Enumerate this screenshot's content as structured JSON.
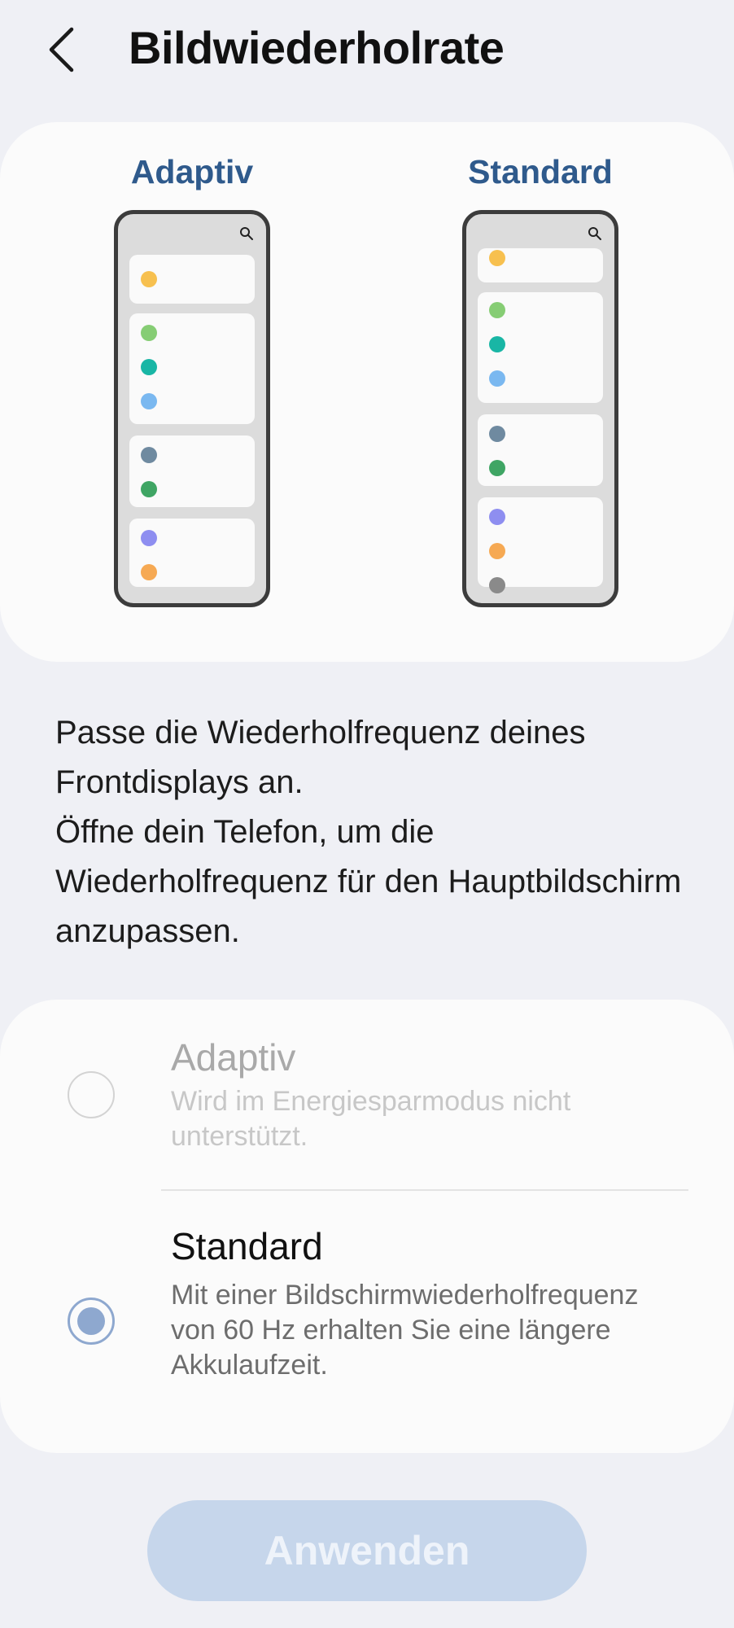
{
  "header": {
    "title": "Bildwiederholrate",
    "back_icon": "chevron-left-icon"
  },
  "preview": {
    "left_label": "Adaptiv",
    "right_label": "Standard",
    "search_icon": "search-icon",
    "dot_colors": {
      "yellow": "#f7c04f",
      "green": "#86cd74",
      "teal": "#19b6a5",
      "blue": "#7ab8f0",
      "slate": "#6f8aa0",
      "darkgreen": "#3fa564",
      "purple": "#8e8ef0",
      "orange": "#f6a953",
      "gray": "#8a8a8a"
    }
  },
  "description": {
    "line1": "Passe die Wiederholfrequenz deines Frontdisplays an.",
    "line2": "Öffne dein Telefon, um die Wiederholfrequenz für den Hauptbildschirm anzupassen."
  },
  "options": [
    {
      "title": "Adaptiv",
      "subtitle": "Wird im Energiesparmodus nicht unterstützt.",
      "selected": false,
      "enabled": false
    },
    {
      "title": "Standard",
      "subtitle": "Mit einer Bildschirmwiederholfrequenz von 60 Hz erhalten Sie eine längere Akkulaufzeit.",
      "selected": true,
      "enabled": true
    }
  ],
  "apply_button": {
    "label": "Anwenden",
    "enabled": false
  },
  "colors": {
    "background": "#eff0f5",
    "card": "#fbfbfb",
    "accent": "#2f5a8c",
    "radio_selected": "#8ea8cf",
    "button_disabled": "#c6d6eb"
  }
}
